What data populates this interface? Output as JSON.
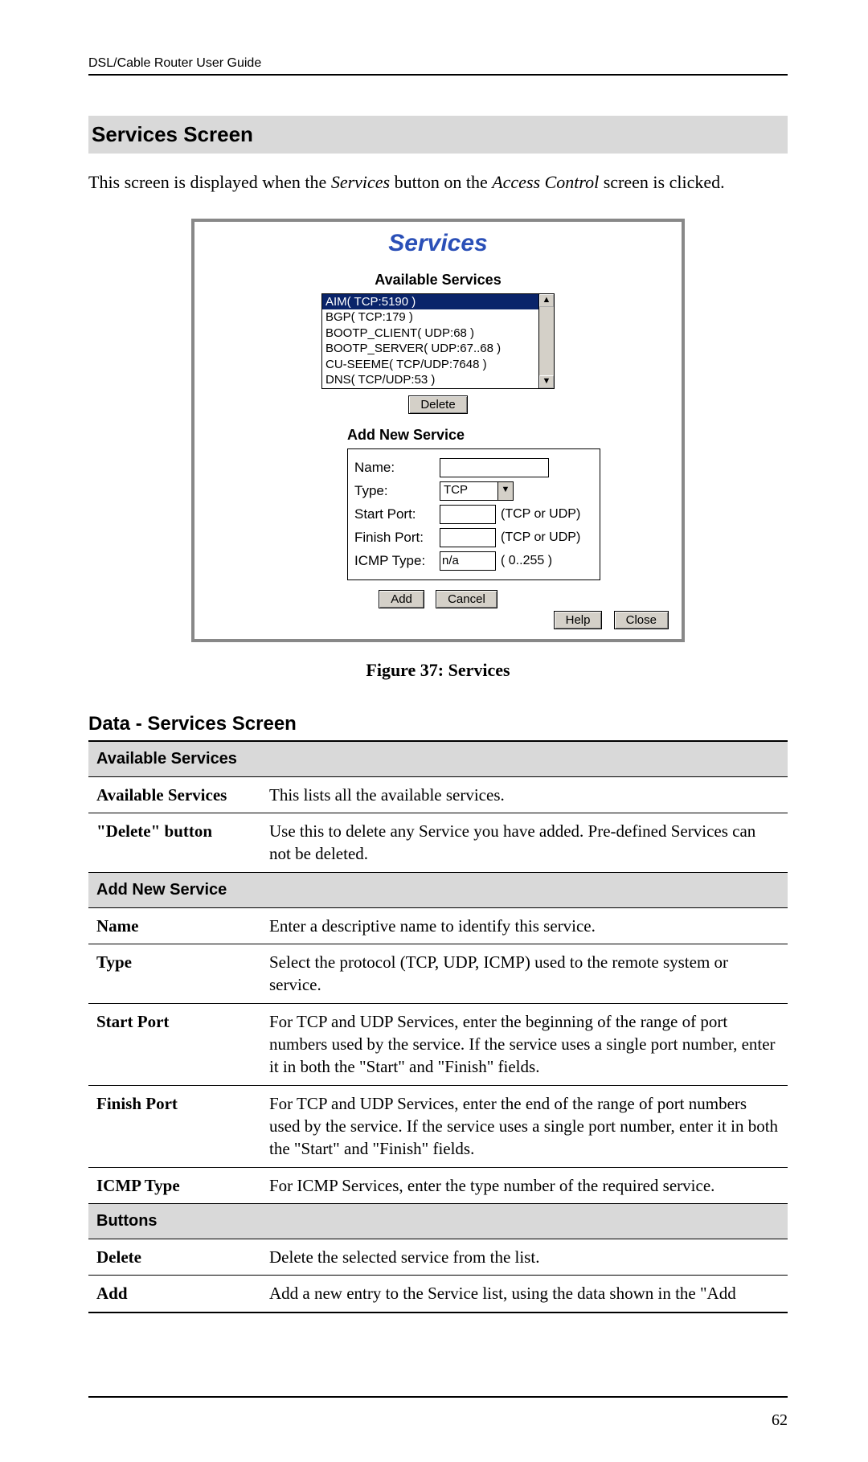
{
  "header": "DSL/Cable Router User Guide",
  "section_title": "Services Screen",
  "intro": {
    "pre": "This screen is displayed when the ",
    "em1": "Services",
    "mid": " button on the ",
    "em2": "Access Control",
    "post": " screen is clicked."
  },
  "shot": {
    "title": "Services",
    "avail_heading": "Available Services",
    "list": [
      "AIM( TCP:5190 )",
      "BGP( TCP:179 )",
      "BOOTP_CLIENT( UDP:68 )",
      "BOOTP_SERVER( UDP:67..68 )",
      "CU-SEEME( TCP/UDP:7648 )",
      "DNS( TCP/UDP:53 )"
    ],
    "delete_btn": "Delete",
    "addnew_heading": "Add New Service",
    "labels": {
      "name": "Name:",
      "type": "Type:",
      "start": "Start Port:",
      "finish": "Finish Port:",
      "icmp": "ICMP Type:"
    },
    "type_value": "TCP",
    "hint_tcpudp": "(TCP or UDP)",
    "icmp_value": "n/a",
    "icmp_hint": "( 0..255 )",
    "add_btn": "Add",
    "cancel_btn": "Cancel",
    "help_btn": "Help",
    "close_btn": "Close"
  },
  "figure_caption": "Figure 37: Services",
  "data_heading": "Data - Services Screen",
  "table": {
    "groups": [
      {
        "title": "Available Services",
        "rows": [
          {
            "key": "Available Services",
            "val": "This lists all the available services."
          },
          {
            "key": "\"Delete\" button",
            "val": "Use this to delete any Service you have added. Pre-defined Services can not be deleted."
          }
        ]
      },
      {
        "title": "Add New Service",
        "rows": [
          {
            "key": "Name",
            "val": "Enter a descriptive name to identify this service."
          },
          {
            "key": "Type",
            "val": "Select the protocol (TCP, UDP, ICMP) used to the remote system or service."
          },
          {
            "key": "Start Port",
            "val": "For TCP and UDP Services, enter the beginning of the range of port numbers used by the service. If the service uses a single port number, enter it in both the \"Start\" and \"Finish\" fields."
          },
          {
            "key": "Finish Port",
            "val": "For TCP and UDP Services, enter the end of the range of port numbers used by the service. If the service uses a single port number, enter it in both the \"Start\" and \"Finish\" fields."
          },
          {
            "key": "ICMP Type",
            "val": "For ICMP Services, enter the type number of the required service."
          }
        ]
      },
      {
        "title": "Buttons",
        "rows": [
          {
            "key": "Delete",
            "val": "Delete the selected service from the list."
          },
          {
            "key": "Add",
            "val": "Add a new entry to the Service list, using the data shown in the \"Add"
          }
        ]
      }
    ]
  },
  "page_number": "62"
}
